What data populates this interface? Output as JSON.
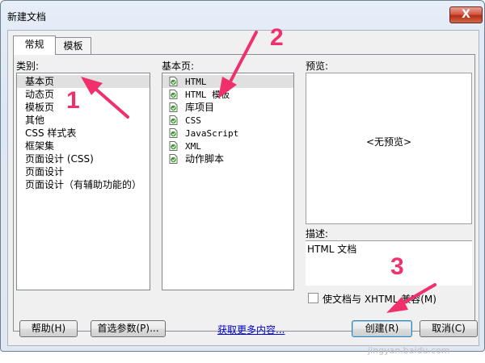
{
  "window": {
    "title": "新建文档",
    "close_label": "X"
  },
  "tabs": [
    {
      "label": "常规",
      "active": true
    },
    {
      "label": "模板",
      "active": false
    }
  ],
  "category": {
    "label": "类别:",
    "items": [
      "基本页",
      "动态页",
      "模板页",
      "其他",
      "CSS 样式表",
      "框架集",
      "页面设计 (CSS)",
      "页面设计",
      "页面设计（有辅助功能的）"
    ],
    "selected_index": 0
  },
  "basic_page": {
    "label": "基本页:",
    "items": [
      "HTML",
      "HTML 模板",
      "库项目",
      "CSS",
      "JavaScript",
      "XML",
      "动作脚本"
    ],
    "selected_index": 0
  },
  "preview": {
    "label": "预览:",
    "text": "<无预览>"
  },
  "description": {
    "label": "描述:",
    "text": "HTML 文档"
  },
  "xhtml_checkbox": {
    "label": "使文档与 XHTML 兼容(M)",
    "checked": false
  },
  "buttons": {
    "help": "帮助(H)",
    "preferences": "首选参数(P)...",
    "more_content": "获取更多内容...",
    "create": "创建(R)",
    "cancel": "取消(C)"
  },
  "annotations": [
    "1",
    "2",
    "3"
  ],
  "watermark": "jingyan.baidu.com",
  "colors": {
    "annotation": "#f0306c",
    "icon_green": "#3a9b2a"
  }
}
